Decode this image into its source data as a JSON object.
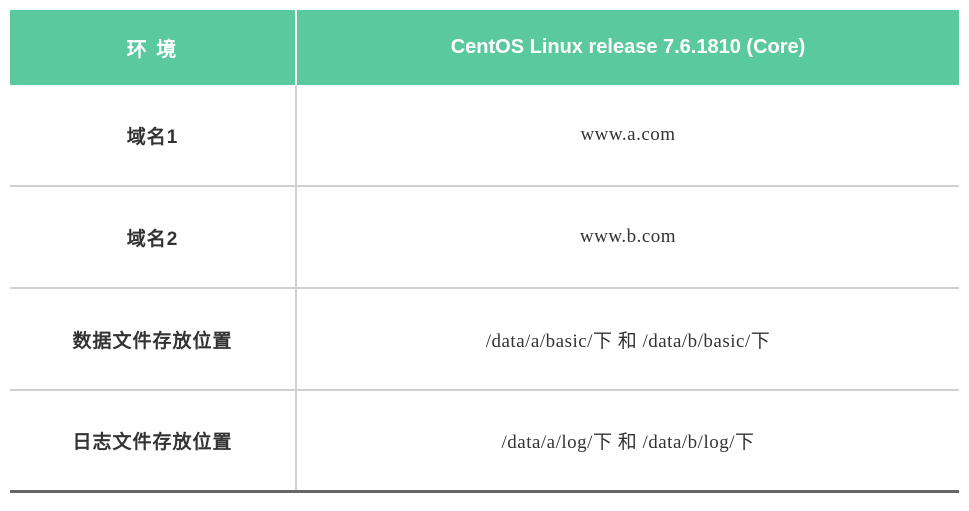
{
  "header": {
    "left": "环 境",
    "right": "CentOS Linux release 7.6.1810 (Core)"
  },
  "rows": [
    {
      "label": "域名1",
      "value": "www.a.com"
    },
    {
      "label": "域名2",
      "value": "www.b.com"
    },
    {
      "label": "数据文件存放位置",
      "value": "/data/a/basic/下 和 /data/b/basic/下"
    },
    {
      "label": "日志文件存放位置",
      "value": "/data/a/log/下 和 /data/b/log/下"
    }
  ]
}
